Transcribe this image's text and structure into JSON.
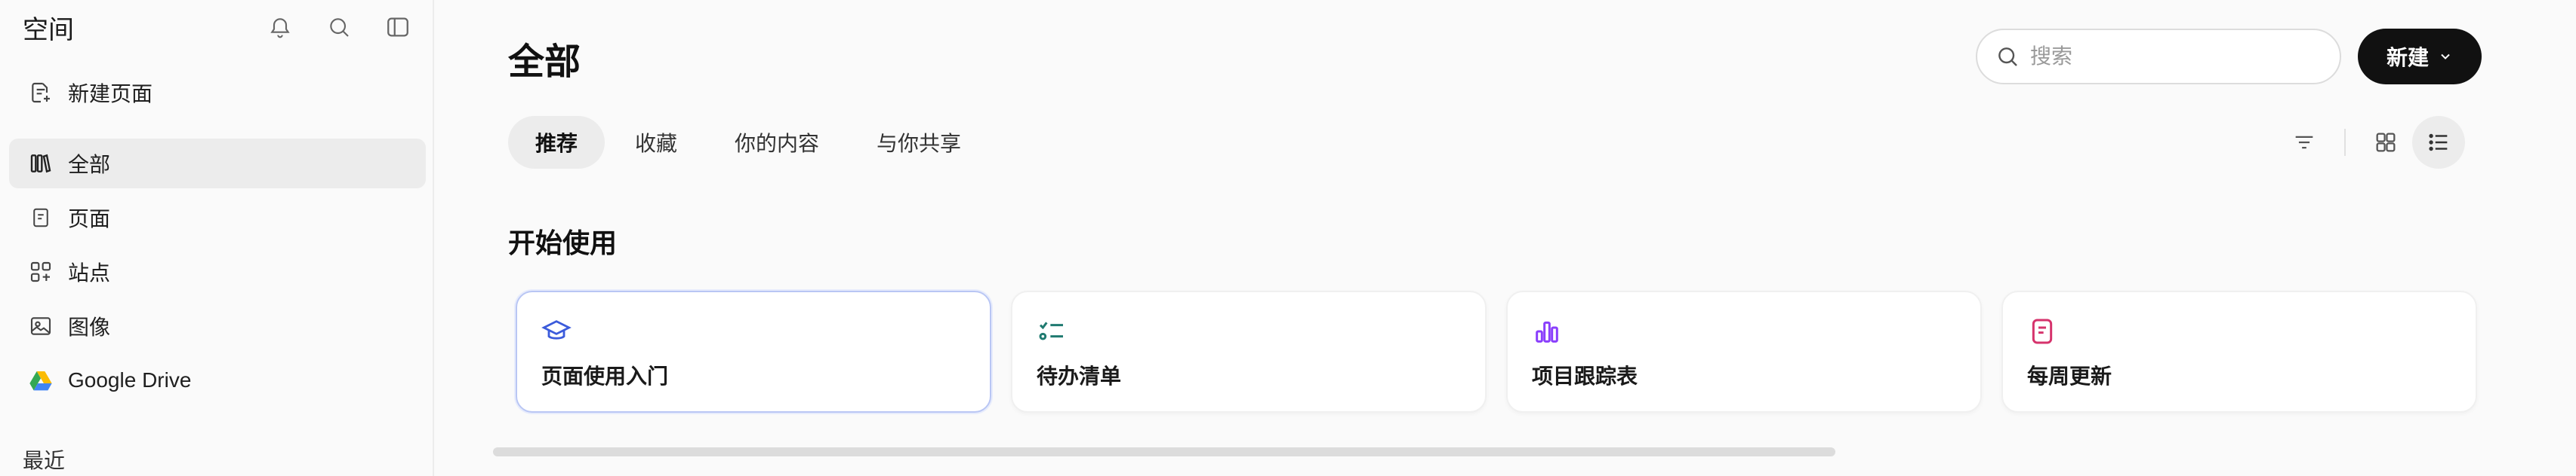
{
  "sidebar": {
    "title": "空间",
    "icons": [
      "bell-icon",
      "search-icon",
      "sidebar-toggle-icon"
    ],
    "new_page": "新建页面",
    "items": [
      {
        "label": "全部",
        "icon": "library-icon",
        "active": true
      },
      {
        "label": "页面",
        "icon": "page-icon",
        "active": false
      },
      {
        "label": "站点",
        "icon": "site-icon",
        "active": false
      },
      {
        "label": "图像",
        "icon": "image-icon",
        "active": false
      },
      {
        "label": "Google Drive",
        "icon": "google-drive-icon",
        "active": false
      }
    ],
    "recent_heading": "最近"
  },
  "main": {
    "title": "全部",
    "search": {
      "placeholder": "搜索",
      "value": ""
    },
    "new_button": "新建",
    "tabs": [
      {
        "label": "推荐",
        "active": true
      },
      {
        "label": "收藏",
        "active": false
      },
      {
        "label": "你的内容",
        "active": false
      },
      {
        "label": "与你共享",
        "active": false
      }
    ],
    "view": {
      "filter_icon": "filter-icon",
      "grid_icon": "grid-view-icon",
      "list_icon": "list-view-icon",
      "active": "list"
    },
    "section_title": "开始使用",
    "cards": [
      {
        "label": "页面使用入门",
        "icon": "graduation-cap-icon",
        "color": "#3b5bdb"
      },
      {
        "label": "待办清单",
        "icon": "checklist-icon",
        "color": "#1f7a70"
      },
      {
        "label": "项目跟踪表",
        "icon": "chart-icon",
        "color": "#8a3ffc"
      },
      {
        "label": "每周更新",
        "icon": "note-icon",
        "color": "#d6336c"
      }
    ]
  },
  "colors": {
    "accent_selected_border": "#b9c6f4",
    "button_bg": "#111111"
  }
}
